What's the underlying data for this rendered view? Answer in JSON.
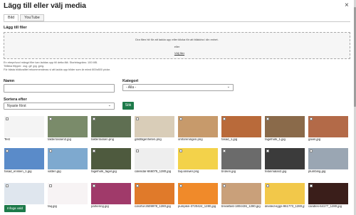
{
  "dialog": {
    "title": "Lägg till eller välj media",
    "close_icon": "×"
  },
  "tabs": [
    {
      "label": "Bild",
      "active": true
    },
    {
      "label": "YouTube",
      "active": false
    }
  ],
  "upload": {
    "heading": "Lägg till filer",
    "drop_text": "Dra filen hit för att ladda upp eller klicka för att bläddra i din enhet.",
    "or_text": "eller",
    "browse_label": "Välj filer",
    "info_lines": [
      "En ebeprövod mängd filer kan laddas upp till detta fält. Storleksgräns: 100 MB.",
      "Tillåtna filtyper: .svg .gif .jpg .jpeg.",
      "För bästa bildkvalitet rekommenderas vi att ladda upp bilder som är minst 800x800 pixlar."
    ]
  },
  "filters": {
    "name_label": "Namn",
    "name_value": "",
    "category_label": "Kategori",
    "category_value": "- Alla -",
    "sort_label": "Sortera efter",
    "sort_value": "Nyaste först",
    "search_label": "Sök"
  },
  "media": [
    {
      "caption": "Test",
      "bg": "#f4f4f4"
    },
    {
      "caption": "takterrassen2.jpg",
      "bg": "#7a8b6a"
    },
    {
      "caption": "takterrassen.png",
      "bg": "#5f6f52"
    },
    {
      "caption": "gästlägenheten.png",
      "bg": "#d9cdb8"
    },
    {
      "caption": "omforeningen.png",
      "bg": "#c79a6b"
    },
    {
      "caption": "fasad_1.jpg",
      "bg": "#b96a3a"
    },
    {
      "caption": "fagelholk_1.jpg",
      "bg": "#8a6a4a"
    },
    {
      "caption": "gavel.jpg",
      "bg": "#b36a48"
    },
    {
      "caption": "fasad_ensken_1.jpg",
      "bg": "#5a8bc9"
    },
    {
      "caption": "vatten.jpg",
      "bg": "#7ea9cf"
    },
    {
      "caption": "fagelholk_fagel.jpg",
      "bg": "#4e5a3e"
    },
    {
      "caption": "calendar-666075_1280.jpg",
      "bg": "#eeeeee"
    },
    {
      "caption": "faq-answer.png",
      "bg": "#f3d24a"
    },
    {
      "caption": "broken.jpg",
      "bg": "#6b6b6b"
    },
    {
      "caption": "felanmalan2.jpg",
      "bg": "#3b3b3b"
    },
    {
      "caption": "plumbing.jpg",
      "bg": "#9aa6b3"
    },
    {
      "caption": "",
      "bg": "#dfe6ee"
    },
    {
      "caption": "faq.jpg",
      "bg": "#f7f3f4"
    },
    {
      "caption": "parkering.jpg",
      "bg": "#a03a6a"
    },
    {
      "caption": "colorful-2609978_1280.jpg",
      "bg": "#e07a2a"
    },
    {
      "caption": "pumpkin-3720424_1280.jpg",
      "bg": "#f08a2a"
    },
    {
      "caption": "breakfast-1804436_1280.jpg",
      "bg": "#c9a07a"
    },
    {
      "caption": "deviled-eggs-961773_1280.jpg",
      "bg": "#f2c84a"
    },
    {
      "caption": "candles-64177_1280.jpg",
      "bg": "#3a1e1a"
    }
  ],
  "actions": {
    "insert_label": "Infoga vald"
  }
}
